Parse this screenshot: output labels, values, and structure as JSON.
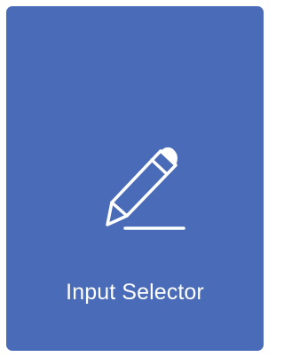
{
  "tile": {
    "label": "Input Selector",
    "icon": "pencil-icon",
    "background_color": "#4a6bb7",
    "foreground_color": "#ffffff"
  }
}
